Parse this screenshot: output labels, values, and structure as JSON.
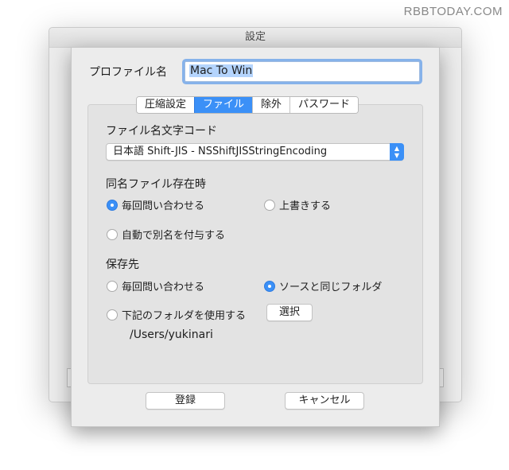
{
  "watermark": "RBBTODAY.COM",
  "window": {
    "title": "設定"
  },
  "profile": {
    "label": "プロファイル名",
    "value": "Mac To Win"
  },
  "tabs": [
    {
      "label": "圧縮設定",
      "active": false
    },
    {
      "label": "ファイル",
      "active": true
    },
    {
      "label": "除外",
      "active": false
    },
    {
      "label": "パスワード",
      "active": false
    }
  ],
  "encoding": {
    "title": "ファイル名文字コード",
    "selected": "日本語 Shift-JIS - NSShiftJISStringEncoding"
  },
  "duplicate": {
    "title": "同名ファイル存在時",
    "options": [
      {
        "label": "毎回問い合わせる",
        "checked": true
      },
      {
        "label": "上書きする",
        "checked": false
      },
      {
        "label": "自動で別名を付与する",
        "checked": false
      }
    ]
  },
  "destination": {
    "title": "保存先",
    "options": [
      {
        "label": "毎回問い合わせる",
        "checked": false
      },
      {
        "label": "ソースと同じフォルダ",
        "checked": true
      },
      {
        "label": "下記のフォルダを使用する",
        "checked": false
      }
    ],
    "choose_label": "選択",
    "path": "/Users/yukinari"
  },
  "footer": {
    "register_label": "登録",
    "cancel_label": "キャンセル"
  },
  "colors": {
    "accent": "#3b90f7",
    "focus_ring": "#86b2ea"
  }
}
